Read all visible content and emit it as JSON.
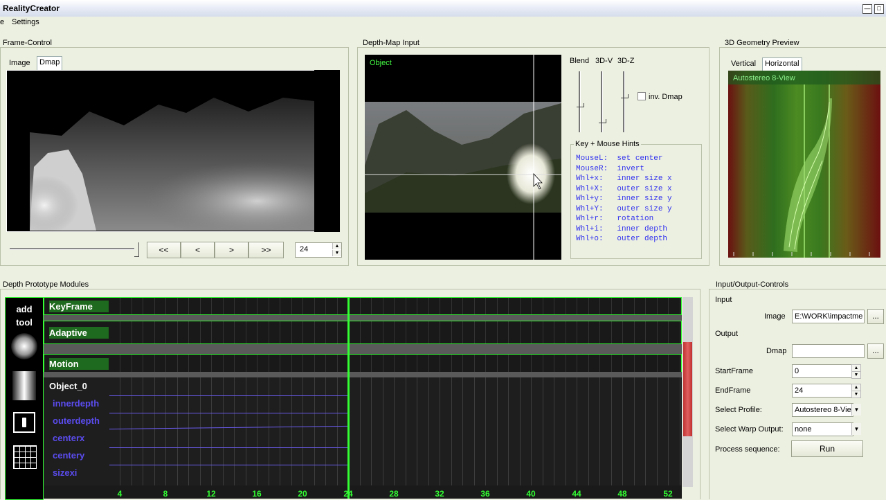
{
  "window": {
    "title": "RealityCreator",
    "min_icon": "minimize-icon",
    "max_icon": "maximize-icon"
  },
  "menu": {
    "items": [
      "e",
      "Settings"
    ]
  },
  "frame_control": {
    "label": "Frame-Control",
    "tabs": [
      "Image",
      "Dmap"
    ],
    "buttons": {
      "first": "<<",
      "prev": "<",
      "next": ">",
      "last": ">>"
    },
    "frame_value": "24",
    "slider_level": 0.95
  },
  "depth_map": {
    "label": "Depth-Map Input",
    "overlay_label": "Object",
    "sliders": [
      "Blend",
      "3D-V",
      "3D-Z"
    ],
    "slider_levels": [
      0.48,
      0.22,
      0.62
    ],
    "inv_dmap_label": "inv. Dmap",
    "inv_dmap_checked": false,
    "hints_label": "Key + Mouse Hints",
    "hints": [
      "MouseL:  set center",
      "MouseR:  invert",
      "Whl+x:   inner size x",
      "Whl+X:   outer size x",
      "Whl+y:   inner size y",
      "Whl+Y:   outer size y",
      "Whl+r:   rotation",
      "Whl+i:   inner depth",
      "Whl+o:   outer depth"
    ]
  },
  "geometry_preview": {
    "label": "3D Geometry Preview",
    "tabs": [
      "Vertical",
      "Horizontal"
    ],
    "overlay_label": "Autostereo 8-View"
  },
  "modules": {
    "label": "Depth Prototype Modules",
    "toolbar": {
      "add_tool": [
        "add",
        "tool"
      ],
      "icons": [
        "sphere-tool-icon",
        "gradient-tool-icon",
        "object-tool-icon",
        "grid-tool-icon"
      ]
    },
    "tracks": [
      {
        "name": "KeyFrame",
        "kind": "module"
      },
      {
        "name": "Adaptive",
        "kind": "module"
      },
      {
        "name": "Motion",
        "kind": "module"
      },
      {
        "name": "Object_0",
        "kind": "object"
      }
    ],
    "params": [
      "innerdepth",
      "outerdepth",
      "centerx",
      "centery",
      "sizexi"
    ],
    "timeline_ticks": [
      "4",
      "8",
      "12",
      "16",
      "20",
      "24",
      "28",
      "32",
      "36",
      "40",
      "44",
      "48",
      "52"
    ],
    "current_frame": 24,
    "accent": "#33ff33"
  },
  "io": {
    "label": "Input/Output-Controls",
    "input_label": "Input",
    "image_label": "Image",
    "image_value": "E:\\WORK\\impactme",
    "output_label": "Output",
    "dmap_label": "Dmap",
    "dmap_value": "",
    "browse": "...",
    "start_label": "StartFrame",
    "start_value": "0",
    "end_label": "EndFrame",
    "end_value": "24",
    "profile_label": "Select Profile:",
    "profile_value": "Autostereo 8-Vie",
    "warp_label": "Select Warp Output:",
    "warp_value": "none",
    "process_label": "Process sequence:",
    "run_label": "Run"
  }
}
